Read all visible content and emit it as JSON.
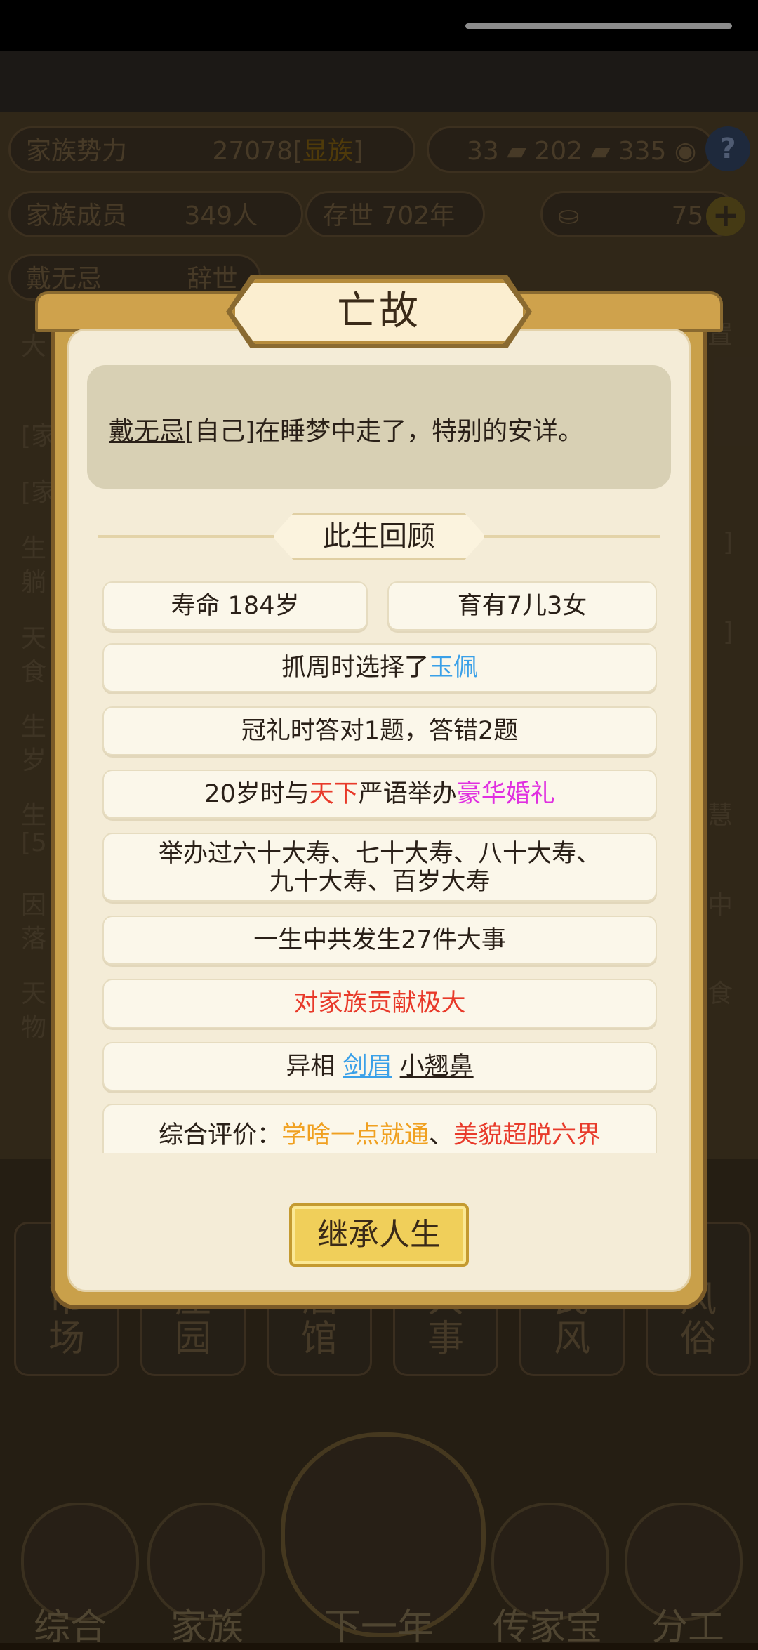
{
  "background": {
    "stats": {
      "power_label": "家族势力",
      "power_value": "27078[",
      "power_tier": "显族",
      "power_close": "]",
      "members_label": "家族成员",
      "members_value": "349人",
      "exist_label": "存世",
      "exist_value": "702年",
      "res1": "33",
      "res2": "202",
      "res3": "335",
      "gold": "75",
      "help": "?",
      "plus": "+",
      "person_name": "戴无忌",
      "person_status": "辞世"
    },
    "left_column": [
      "[家",
      "[家",
      "生",
      "躺",
      "天",
      "食",
      "生",
      "岁",
      "生",
      "[5",
      "因",
      "落",
      "天",
      "物",
      "大"
    ],
    "right_column": [
      "]",
      "]",
      "慧",
      "中",
      "食",
      "置"
    ],
    "tiles": [
      "场",
      "园",
      "馆",
      "事",
      "风",
      "俗"
    ],
    "tile_partials": [
      "市",
      "庄",
      "酒",
      "大",
      "民",
      "风"
    ],
    "nav": [
      "综合",
      "家族",
      "下一年",
      "传家宝",
      "分工"
    ]
  },
  "modal": {
    "title": "亡故",
    "message": {
      "name": "戴无忌",
      "rest": "[自己]在睡梦中走了，特别的安详。"
    },
    "section_title": "此生回顾",
    "lifespan": "寿命 184岁",
    "children": "育有7儿3女",
    "zhuazhou": {
      "prefix": "抓周时选择了",
      "item": "玉佩"
    },
    "guanli": "冠礼时答对1题，答错2题",
    "marriage": {
      "prefix": "20岁时与",
      "place": "天下",
      "middle": "严语举办",
      "type": "豪华婚礼"
    },
    "birthdays_line1": "举办过六十大寿、七十大寿、八十大寿、",
    "birthdays_line2": "九十大寿、百岁大寿",
    "events": "一生中共发生27件大事",
    "contribution": "对家族贡献极大",
    "features": {
      "label": "异相",
      "f1": "剑眉",
      "f2": "小翘鼻"
    },
    "evaluation": {
      "label": "综合评价：",
      "e1": "学啥一点就通",
      "sep": "、",
      "e2": "美貌超脱六界"
    },
    "button": "继承人生"
  }
}
